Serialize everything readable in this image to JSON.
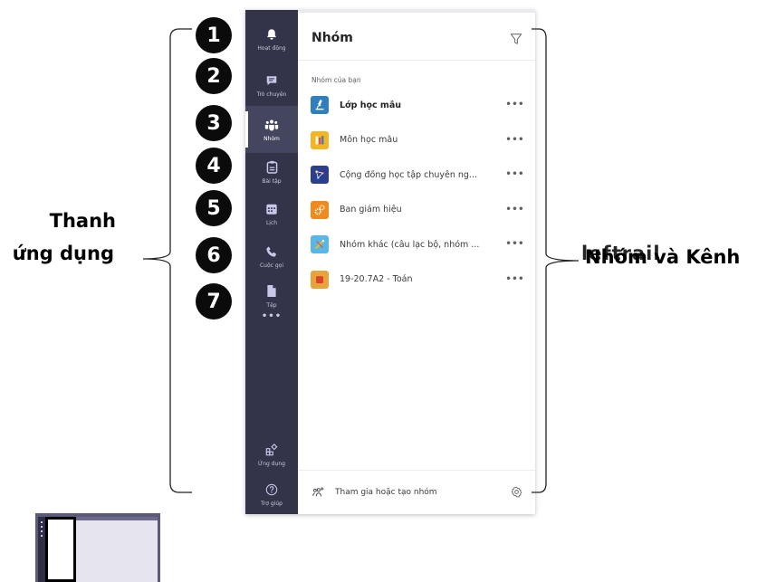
{
  "annotations": {
    "left_label_line1": "Thanh",
    "left_label_line2": "ứng dụng",
    "right_label": "Nhóm và Kênh",
    "right_label_overlay": "leftrail",
    "numbers": [
      "1",
      "2",
      "3",
      "4",
      "5",
      "6",
      "7"
    ]
  },
  "app_bar": {
    "items": [
      {
        "label": "Hoạt động",
        "icon": "bell-icon"
      },
      {
        "label": "Trò chuyện",
        "icon": "chat-icon"
      },
      {
        "label": "Nhóm",
        "icon": "teams-icon",
        "active": true
      },
      {
        "label": "Bài tập",
        "icon": "assignments-icon"
      },
      {
        "label": "Lịch",
        "icon": "calendar-icon"
      },
      {
        "label": "Cuộc gọi",
        "icon": "phone-icon"
      },
      {
        "label": "Tệp",
        "icon": "file-icon"
      }
    ],
    "more": "•••",
    "bottom_items": [
      {
        "label": "Ứng dụng",
        "icon": "apps-icon"
      },
      {
        "label": "Trợ giúp",
        "icon": "help-icon"
      }
    ]
  },
  "panel": {
    "title": "Nhóm",
    "section_label": "Nhóm của bạn",
    "teams": [
      {
        "name": "Lớp học mẫu",
        "bold": true,
        "avatar_color": "#2f7fbf"
      },
      {
        "name": "Môn học mẫu",
        "bold": false,
        "avatar_color": "#f4b522"
      },
      {
        "name": "Cộng đồng học tập chuyên ng...",
        "bold": false,
        "avatar_color": "#2c3f8f"
      },
      {
        "name": "Ban giám hiệu",
        "bold": false,
        "avatar_color": "#f08a1c"
      },
      {
        "name": "Nhóm khác (câu lạc bộ, nhóm ...",
        "bold": false,
        "avatar_color": "#59b7e6"
      },
      {
        "name": "19-20.7A2 - Toán",
        "bold": false,
        "avatar_color": "#e8a33a"
      }
    ],
    "more_icon": "•••",
    "footer_text": "Tham gia hoặc tạo nhóm"
  },
  "colors": {
    "app_bar": "#33344a",
    "accent": "#6264a7"
  }
}
